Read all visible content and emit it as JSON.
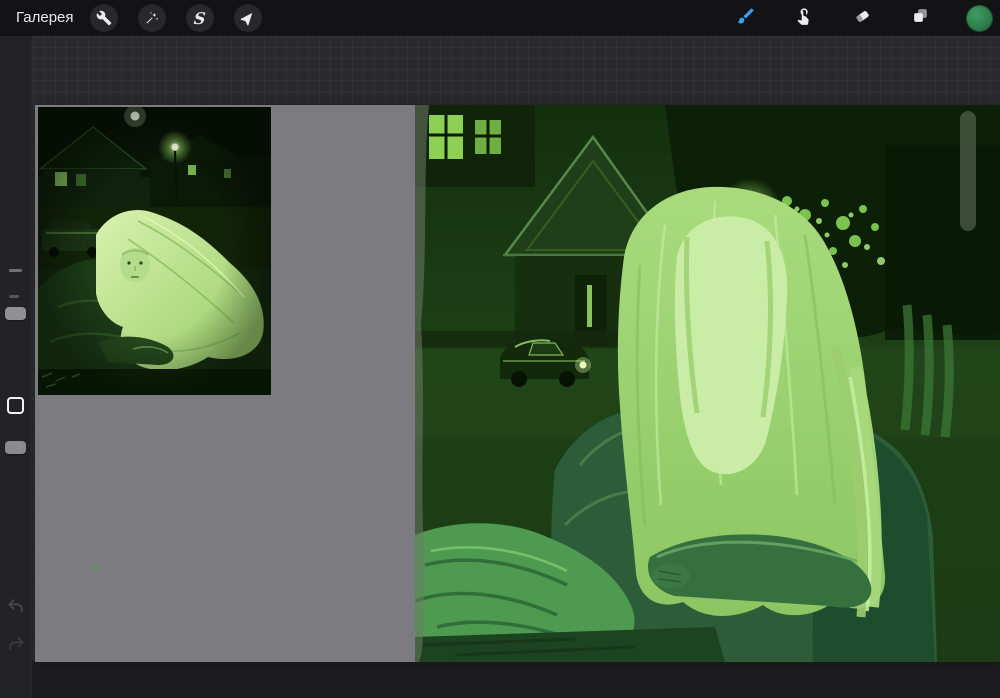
{
  "app": "procreate-canvas-view",
  "topbar": {
    "gallery_label": "Галерея",
    "left_tools": [
      {
        "id": "actions",
        "icon": "wrench-icon"
      },
      {
        "id": "adjustments",
        "icon": "magic-wand-icon"
      },
      {
        "id": "selection",
        "icon": "selection-s-icon",
        "glyph": "S"
      },
      {
        "id": "transform",
        "icon": "transform-arrow-icon"
      }
    ],
    "right_tools": [
      {
        "id": "paint",
        "icon": "paintbrush-icon",
        "active": true
      },
      {
        "id": "smudge",
        "icon": "smudge-finger-icon"
      },
      {
        "id": "erase",
        "icon": "eraser-icon"
      },
      {
        "id": "layers",
        "icon": "layers-icon"
      },
      {
        "id": "color",
        "icon": "color-swatch"
      }
    ]
  },
  "sidebar": {
    "controls": [
      "brush-size-slider",
      "modify-button",
      "opacity-slider",
      "undo-button",
      "redo-button"
    ]
  },
  "canvas": {
    "items": [
      "reference-photo",
      "painting-in-progress"
    ]
  },
  "colors": {
    "topbar_bg": "#131315",
    "button_bg": "#28282b",
    "icon_color": "#ececee",
    "accent_blue": "#3aa0f2",
    "swatch_green": "#2e7d4b",
    "workspace_bg": "#2a2a2c",
    "sidebar_bg": "#232325",
    "canvas_gray": "#7c7c80",
    "hair_green": "#a9db7d",
    "face_green": "#c9eca6",
    "jacket_green": "#2d5c38",
    "fabric_green": "#4e9a50",
    "dark_green": "#16320f",
    "glow_green": "#9ad860"
  }
}
